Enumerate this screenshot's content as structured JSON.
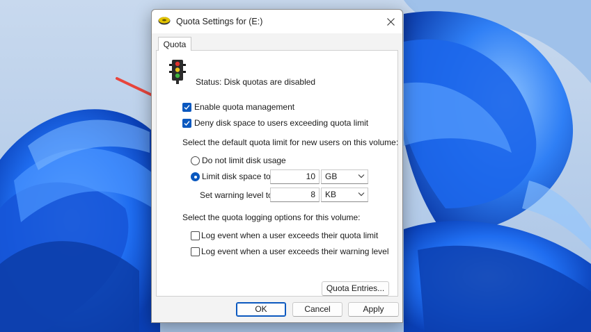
{
  "dialog": {
    "title": "Quota Settings for  (E:)",
    "tab_label": "Quota",
    "status": "Status:  Disk quotas are disabled",
    "enable_quota": {
      "label": "Enable quota management",
      "checked": true
    },
    "deny_space": {
      "label": "Deny disk space to users exceeding quota limit",
      "checked": true
    },
    "default_limit_heading": "Select the default quota limit for new users on this volume:",
    "no_limit": {
      "label": "Do not limit disk usage",
      "selected": false
    },
    "limit_space": {
      "label": "Limit disk space to",
      "selected": true,
      "value": "10",
      "unit": "GB"
    },
    "warning_level": {
      "label": "Set warning level to",
      "value": "8",
      "unit": "KB"
    },
    "logging_heading": "Select the quota logging options for this volume:",
    "log_quota": {
      "label": "Log event when a user exceeds their quota limit",
      "checked": false
    },
    "log_warning": {
      "label": "Log event when a user exceeds their warning level",
      "checked": false
    },
    "quota_entries_button": "Quota Entries...",
    "ok_button": "OK",
    "cancel_button": "Cancel",
    "apply_button": "Apply"
  },
  "icons": {
    "title": "disk-drive-icon",
    "status": "traffic-light-icon",
    "close": "close-icon",
    "annotation": "red-arrow-icon"
  },
  "colors": {
    "accent": "#0a58bf",
    "annotation_arrow": "#e8453c"
  }
}
